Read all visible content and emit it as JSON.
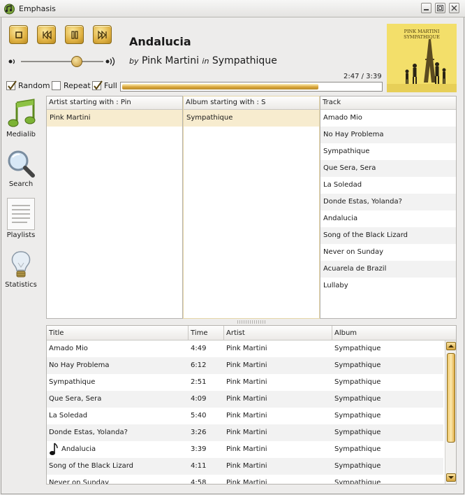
{
  "window": {
    "title": "Emphasis"
  },
  "track": {
    "title": "Andalucia",
    "by": "by",
    "artist": "Pink Martini",
    "in": "in",
    "album": "Sympathique"
  },
  "cover": {
    "line1": "PINK MARTINI",
    "line2": "SYMPATHIQUE",
    "bg": "#f3df6a"
  },
  "playback": {
    "time": "2:47 / 3:39",
    "progress": 0.76,
    "volume": 0.68
  },
  "options": [
    {
      "label": "Random",
      "checked": true
    },
    {
      "label": "Repeat",
      "checked": false
    },
    {
      "label": "Full",
      "checked": true
    }
  ],
  "nav": [
    {
      "label": "Medialib",
      "icon": "music-note-icon"
    },
    {
      "label": "Search",
      "icon": "magnifier-icon"
    },
    {
      "label": "Playlists",
      "icon": "list-icon"
    },
    {
      "label": "Statistics",
      "icon": "lightbulb-icon"
    }
  ],
  "browser": {
    "artist_header": "Artist starting with : Pin",
    "album_header": "Album starting with : S",
    "track_header": "Track",
    "artists": [
      "Pink Martini"
    ],
    "albums": [
      "Sympathique"
    ],
    "tracks": [
      "Amado Mio",
      "No Hay Problema",
      "Sympathique",
      "Que Sera, Sera",
      "La Soledad",
      "Donde Estas, Yolanda?",
      "Andalucia",
      "Song of the Black Lizard",
      "Never on Sunday",
      "Acuarela de Brazil",
      "Lullaby"
    ]
  },
  "playlist": {
    "headers": {
      "title": "Title",
      "time": "Time",
      "artist": "Artist",
      "album": "Album"
    },
    "playing_index": 6,
    "rows": [
      {
        "title": "Amado Mio",
        "time": "4:49",
        "artist": "Pink Martini",
        "album": "Sympathique"
      },
      {
        "title": "No Hay Problema",
        "time": "6:12",
        "artist": "Pink Martini",
        "album": "Sympathique"
      },
      {
        "title": "Sympathique",
        "time": "2:51",
        "artist": "Pink Martini",
        "album": "Sympathique"
      },
      {
        "title": "Que Sera, Sera",
        "time": "4:09",
        "artist": "Pink Martini",
        "album": "Sympathique"
      },
      {
        "title": "La Soledad",
        "time": "5:40",
        "artist": "Pink Martini",
        "album": "Sympathique"
      },
      {
        "title": "Donde Estas, Yolanda?",
        "time": "3:26",
        "artist": "Pink Martini",
        "album": "Sympathique"
      },
      {
        "title": "Andalucia",
        "time": "3:39",
        "artist": "Pink Martini",
        "album": "Sympathique"
      },
      {
        "title": "Song of the Black Lizard",
        "time": "4:11",
        "artist": "Pink Martini",
        "album": "Sympathique"
      },
      {
        "title": "Never on Sunday",
        "time": "4:58",
        "artist": "Pink Martini",
        "album": "Sympathique"
      }
    ]
  }
}
